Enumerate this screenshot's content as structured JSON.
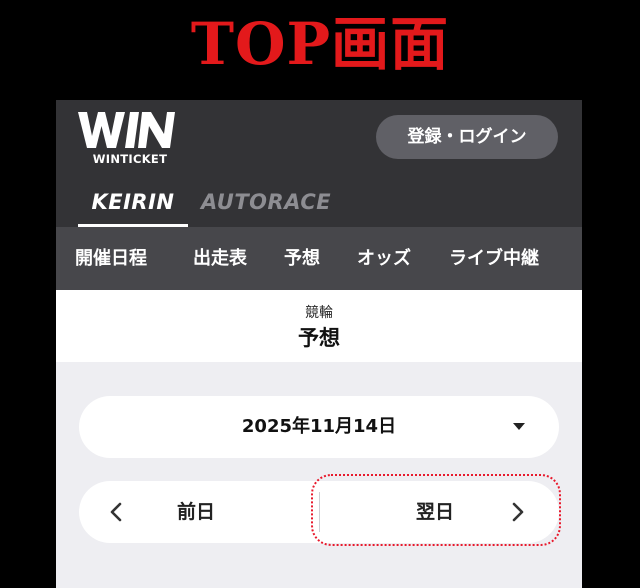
{
  "heading": "TOP画面",
  "header": {
    "logo_mark": "WIN",
    "logo_sub": "WINTICKET",
    "login_label": "登録・ログイン"
  },
  "tabs": [
    {
      "label": "KEIRIN",
      "active": true
    },
    {
      "label": "AUTORACE",
      "active": false
    }
  ],
  "menu": [
    "開催日程",
    "出走表",
    "予想",
    "オッズ",
    "ライブ中継"
  ],
  "subheader": {
    "category": "競輪",
    "title": "予想"
  },
  "date_selector": {
    "value": "2025年11月14日",
    "icon": "caret-down-icon"
  },
  "day_nav": {
    "prev_label": "前日",
    "next_label": "翌日",
    "prev_icon": "chevron-left-icon",
    "next_icon": "chevron-right-icon"
  },
  "colors": {
    "heading": "#e3191b",
    "topbar": "#333336",
    "menubar": "#47474b",
    "login_button": "#606066",
    "inactive_tab": "#8d8d92",
    "content_bg": "#eeeef2",
    "highlight": "#e8192c"
  }
}
